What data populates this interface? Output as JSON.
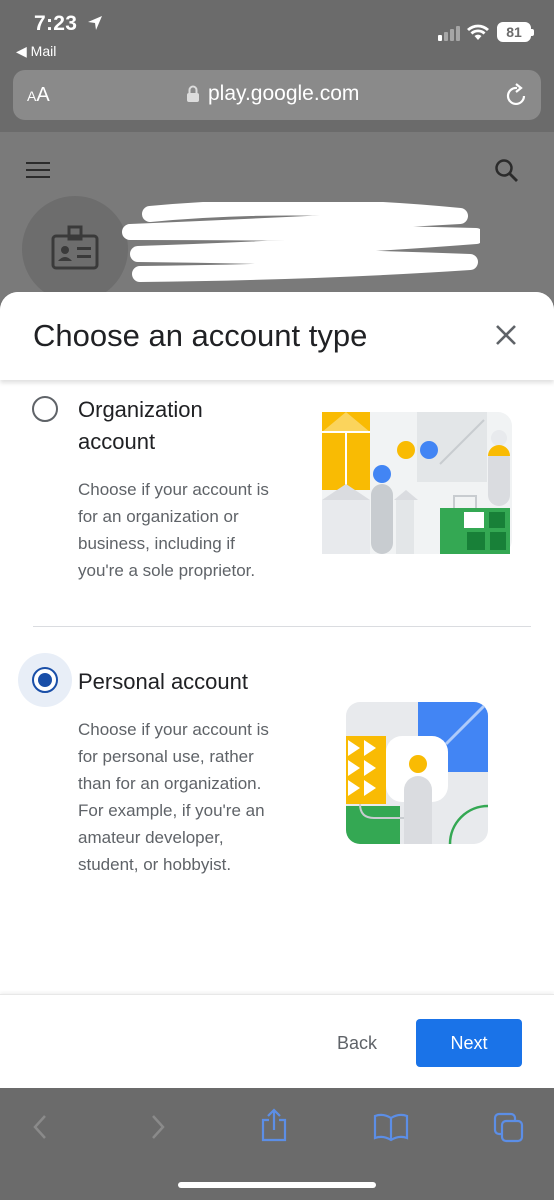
{
  "status_bar": {
    "time": "7:23",
    "back_app": "Mail",
    "battery": "81"
  },
  "browser": {
    "text_size_label_small": "A",
    "text_size_label_large": "A",
    "url": "play.google.com"
  },
  "sheet": {
    "title": "Choose an account type",
    "options": [
      {
        "title_line1": "Organization",
        "title_line2": "account",
        "desc_lines": [
          "Choose if your account is",
          "for an organization or",
          "business, including if",
          "you're a sole proprietor."
        ],
        "selected": false
      },
      {
        "title_line1": "Personal account",
        "desc_lines": [
          "Choose if your account is",
          "for personal use, rather",
          "than for an organization.",
          "For example, if you're an",
          "amateur developer,",
          "student, or hobbyist."
        ],
        "selected": true
      }
    ],
    "back_label": "Back",
    "next_label": "Next"
  },
  "colors": {
    "primary": "#1a73e8",
    "radio_selected": "#1a4fa8",
    "illus_yellow": "#f9bb03",
    "illus_blue": "#4285f4",
    "illus_green": "#34a853"
  },
  "icons": [
    "location-arrow-icon",
    "signal-icon",
    "wifi-icon",
    "battery-icon",
    "lock-icon",
    "reload-icon",
    "menu-icon",
    "search-icon",
    "badge-icon",
    "close-icon",
    "back-nav-icon",
    "forward-nav-icon",
    "share-icon",
    "bookmarks-icon",
    "tabs-icon"
  ]
}
